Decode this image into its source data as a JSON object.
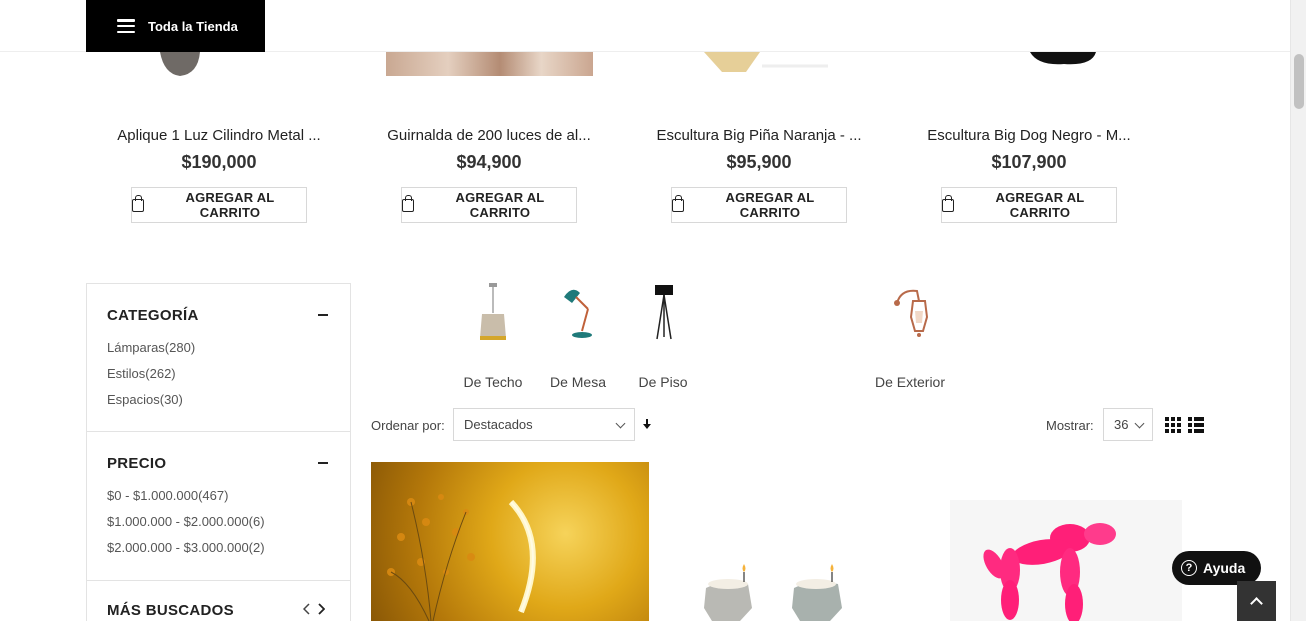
{
  "header": {
    "store_button_label": "Toda la Tienda"
  },
  "top_products": [
    {
      "name": "Aplique 1 Luz Cilindro Metal ...",
      "price": "$190,000",
      "cart_label": "AGREGAR AL CARRITO"
    },
    {
      "name": "Guirnalda de 200 luces de al...",
      "price": "$94,900",
      "cart_label": "AGREGAR AL CARRITO"
    },
    {
      "name": "Escultura Big Piña Naranja - ...",
      "price": "$95,900",
      "cart_label": "AGREGAR AL CARRITO"
    },
    {
      "name": "Escultura Big Dog Negro - M...",
      "price": "$107,900",
      "cart_label": "AGREGAR AL CARRITO"
    }
  ],
  "sidebar": {
    "categoria": {
      "title": "CATEGORÍA",
      "items": [
        "Lámparas(280)",
        "Estilos(262)",
        "Espacios(30)"
      ]
    },
    "precio": {
      "title": "PRECIO",
      "items": [
        "$0 - $1.000.000(467)",
        "$1.000.000 - $2.000.000(6)",
        "$2.000.000 - $3.000.000(2)"
      ]
    },
    "mas_buscados": {
      "title": "MÁS BUSCADOS"
    }
  },
  "categories": [
    {
      "label": "De Techo",
      "icon": "ceiling-lamp-icon"
    },
    {
      "label": "De Mesa",
      "icon": "desk-lamp-icon"
    },
    {
      "label": "De Piso",
      "icon": "floor-lamp-icon"
    },
    {
      "label": "De Exterior",
      "icon": "wall-lantern-icon"
    }
  ],
  "toolbar": {
    "sort_label": "Ordenar por:",
    "sort_value": "Destacados",
    "show_label": "Mostrar:",
    "show_value": "36"
  },
  "help": {
    "label": "Ayuda",
    "icon": "question-icon"
  },
  "colors": {
    "black": "#000000",
    "text": "#222222",
    "border": "#e3e3e3"
  }
}
